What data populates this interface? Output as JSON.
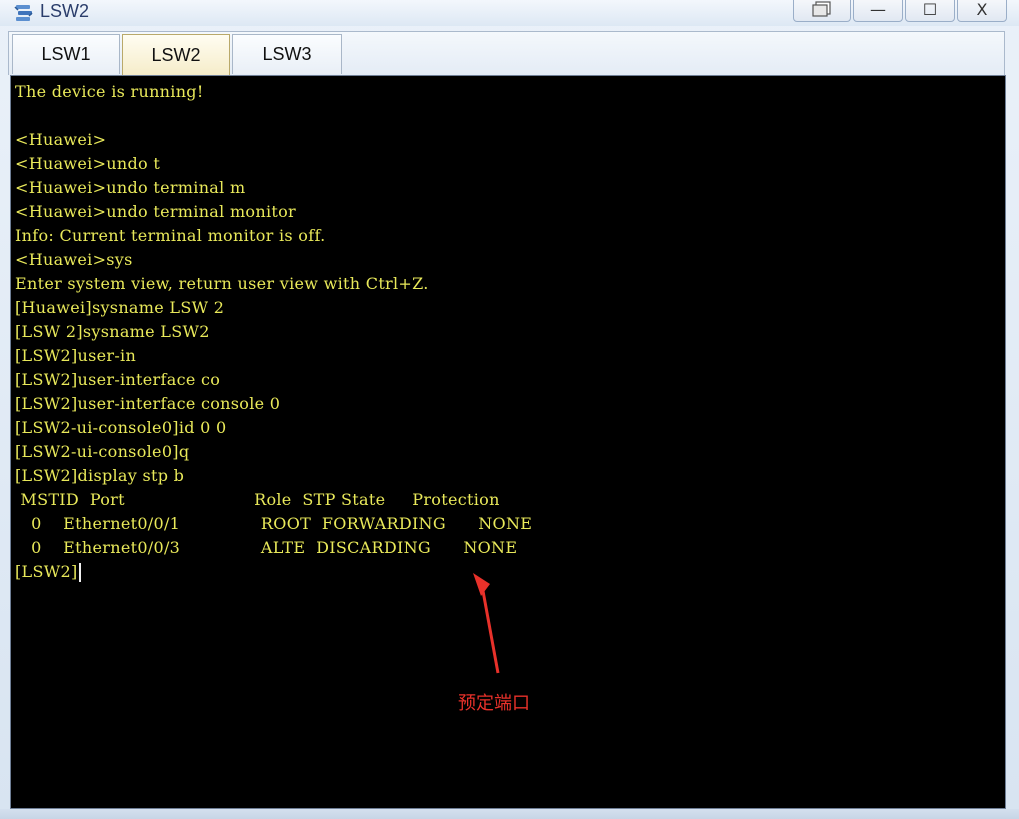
{
  "window": {
    "title": "LSW2",
    "icon": "network-device-icon",
    "controls": [
      "restore-down-icon",
      "minimize-icon",
      "maximize-icon",
      "close-icon"
    ],
    "minimize_glyph": "—",
    "maximize_glyph": "☐",
    "close_glyph": "X"
  },
  "tabs": [
    {
      "label": "LSW1",
      "active": false
    },
    {
      "label": "LSW2",
      "active": true
    },
    {
      "label": "LSW3",
      "active": false
    }
  ],
  "terminal": {
    "text_color": "#e9e95a",
    "background": "#000000",
    "lines": [
      "The device is running!",
      "",
      "<Huawei>",
      "<Huawei>undo t",
      "<Huawei>undo terminal m",
      "<Huawei>undo terminal monitor",
      "Info: Current terminal monitor is off.",
      "<Huawei>sys",
      "Enter system view, return user view with Ctrl+Z.",
      "[Huawei]sysname LSW 2",
      "[LSW 2]sysname LSW2",
      "[LSW2]user-in",
      "[LSW2]user-interface co",
      "[LSW2]user-interface console 0",
      "[LSW2-ui-console0]id 0 0",
      "[LSW2-ui-console0]q",
      "[LSW2]display stp b",
      " MSTID  Port                        Role  STP State     Protection",
      "   0    Ethernet0/0/1               ROOT  FORWARDING      NONE",
      "   0    Ethernet0/0/3               ALTE  DISCARDING      NONE"
    ],
    "prompt": "[LSW2]"
  },
  "annotation": {
    "text": "预定端口",
    "color": "#e8312a"
  }
}
